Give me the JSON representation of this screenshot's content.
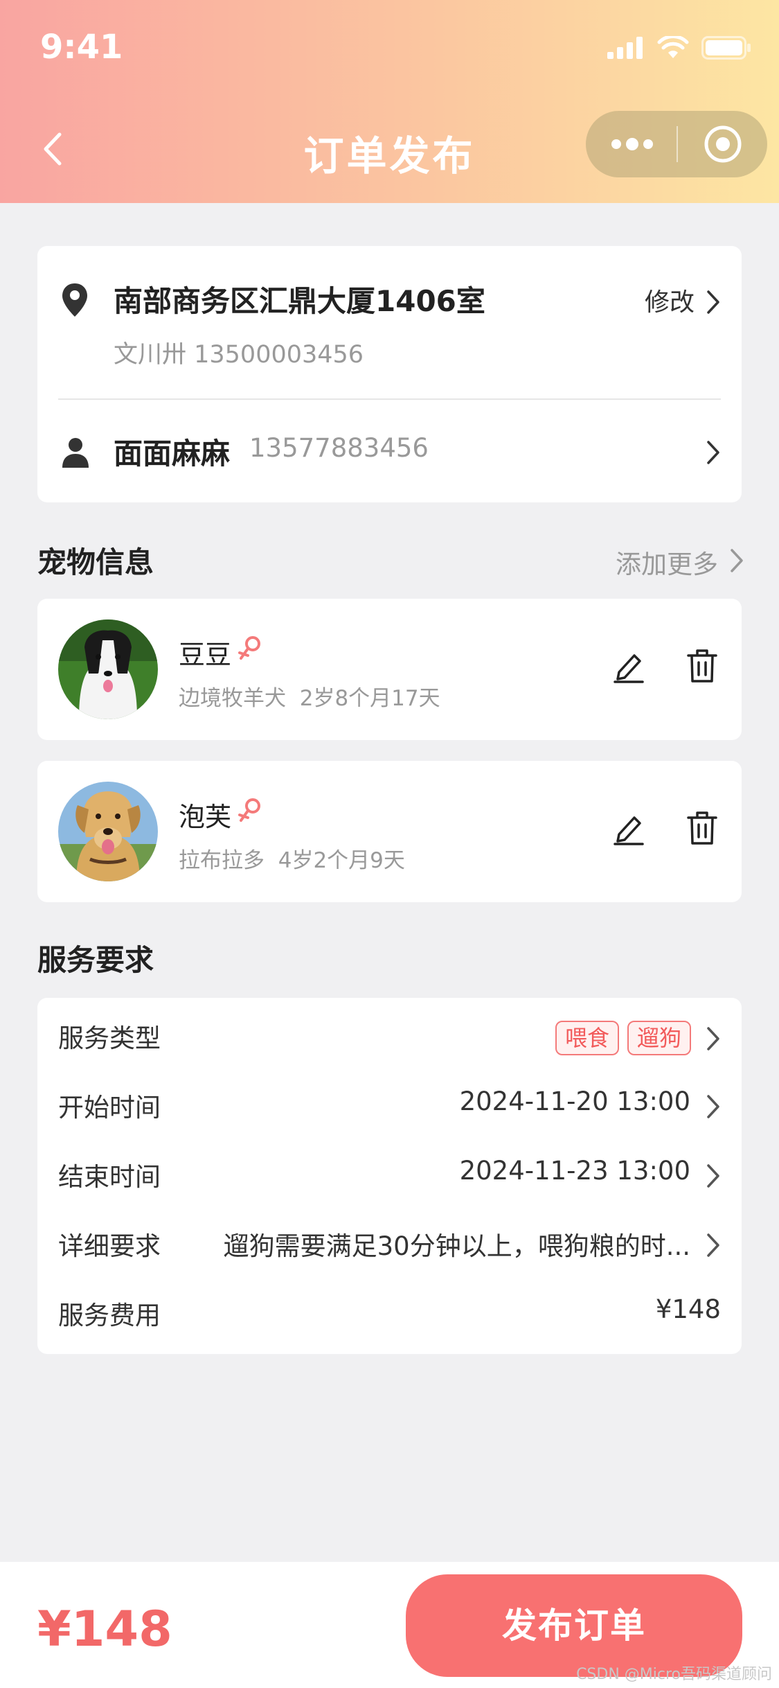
{
  "status_bar": {
    "time": "9:41"
  },
  "nav": {
    "title": "订单发布"
  },
  "address": {
    "text": "南部商务区汇鼎大厦1406室",
    "contact": "文川卅  13500003456",
    "edit_label": "修改"
  },
  "contact": {
    "name": "面面麻麻",
    "phone": "13577883456"
  },
  "pets": {
    "section_title": "宠物信息",
    "add_more": "添加更多",
    "items": [
      {
        "name": "豆豆",
        "breed": "边境牧羊犬",
        "age": "2岁8个月17天",
        "gender": "female"
      },
      {
        "name": "泡芙",
        "breed": "拉布拉多",
        "age": "4岁2个月9天",
        "gender": "female"
      }
    ]
  },
  "service": {
    "section_title": "服务要求",
    "type_label": "服务类型",
    "tags": [
      "喂食",
      "遛狗"
    ],
    "start_label": "开始时间",
    "start_value": "2024-11-20  13:00",
    "end_label": "结束时间",
    "end_value": "2024-11-23  13:00",
    "detail_label": "详细要求",
    "detail_value": "遛狗需要满足30分钟以上，喂狗粮的时...",
    "fee_label": "服务费用",
    "fee_value": "¥148"
  },
  "footer": {
    "total": "¥148",
    "publish_label": "发布订单",
    "watermark": "CSDN @Micro吾码渠道顾问"
  },
  "colors": {
    "accent": "#f87171",
    "price": "#f26868",
    "header_start": "#f9a5a1",
    "header_end": "#fde6a3"
  }
}
